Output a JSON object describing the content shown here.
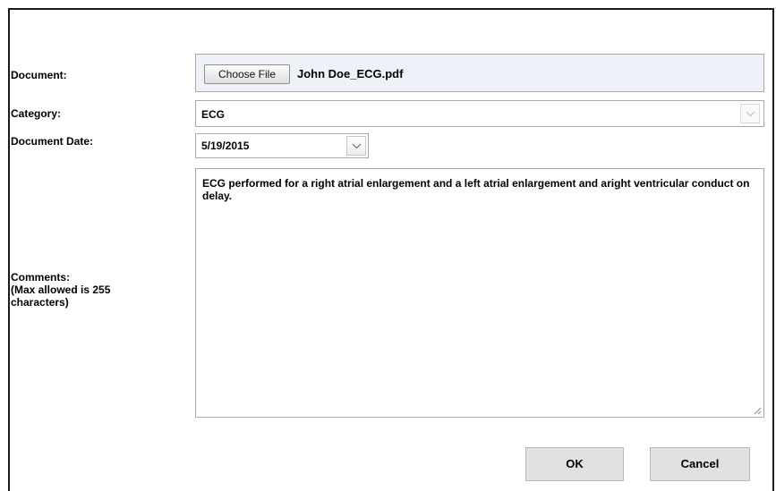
{
  "form": {
    "document_label": "Document:",
    "choose_file_label": "Choose File",
    "file_name": "John Doe_ECG.pdf",
    "category_label": "Category:",
    "category_value": "ECG",
    "date_label": "Document Date:",
    "date_value": "5/19/2015",
    "comments_label_line1": "Comments:",
    "comments_label_line2": "(Max allowed is 255",
    "comments_label_line3": "characters)",
    "comments_value": "ECG performed for a right atrial enlargement and a left atrial enlargement and aright ventricular conduct on delay."
  },
  "buttons": {
    "ok_label": "OK",
    "cancel_label": "Cancel"
  },
  "icons": {
    "dropdown": "chevron-down-icon",
    "resize": "resize-grip-icon"
  }
}
